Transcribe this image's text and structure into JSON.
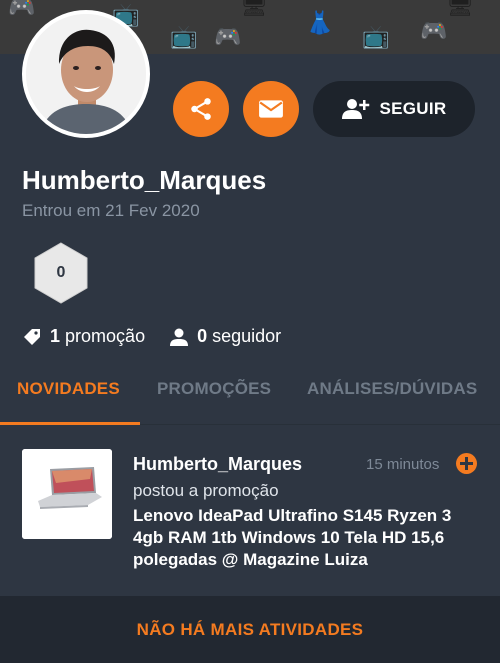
{
  "profile": {
    "username": "Humberto_Marques",
    "joined": "Entrou em 21 Fev 2020",
    "level": "0"
  },
  "actions": {
    "share_icon": "share-icon",
    "mail_icon": "mail-icon",
    "follow_label": "SEGUIR",
    "accent_color": "#f47b20"
  },
  "stats": {
    "promotions_count": "1",
    "promotions_label": "promoção",
    "followers_count": "0",
    "followers_label": "seguidor"
  },
  "tabs": [
    {
      "label": "NOVIDADES",
      "active": true
    },
    {
      "label": "PROMOÇÕES",
      "active": false
    },
    {
      "label": "ANÁLISES/DÚVIDAS",
      "active": false
    }
  ],
  "feed": {
    "user": "Humberto_Marques",
    "time": "15 minutos",
    "action": "postou a promoção",
    "title": "Lenovo IdeaPad Ultrafino S145 Ryzen 3 4gb RAM 1tb Windows 10 Tela HD 15,6 polegadas @ Magazine Luiza"
  },
  "footer": {
    "label": "NÃO HÁ MAIS ATIVIDADES"
  }
}
